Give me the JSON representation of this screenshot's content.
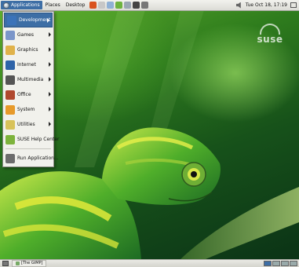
{
  "top_panel": {
    "applications_label": "Applications",
    "places_label": "Places",
    "desktop_label": "Desktop",
    "launchers": [
      {
        "icon": "firefox-icon",
        "color": "#d9531e"
      },
      {
        "icon": "mail-icon",
        "color": "#c7c7c7"
      },
      {
        "icon": "office-icon",
        "color": "#8fb0d6"
      },
      {
        "icon": "help-icon",
        "color": "#6db33f"
      },
      {
        "icon": "search-icon",
        "color": "#9aa6b3"
      },
      {
        "icon": "terminal-icon",
        "color": "#444444"
      },
      {
        "icon": "screenshot-icon",
        "color": "#777777"
      }
    ],
    "clock": "Tue Oct 18, 17:19"
  },
  "applications_menu": {
    "items": [
      {
        "label": "Development",
        "icon": "development-icon",
        "color": "#3b73b9",
        "submenu": true,
        "selected": true
      },
      {
        "label": "Games",
        "icon": "games-icon",
        "color": "#7b96c9",
        "submenu": true
      },
      {
        "label": "Graphics",
        "icon": "graphics-icon",
        "color": "#e0b24a",
        "submenu": true
      },
      {
        "label": "Internet",
        "icon": "internet-icon",
        "color": "#2f64a8",
        "submenu": true
      },
      {
        "label": "Multimedia",
        "icon": "multimedia-icon",
        "color": "#555555",
        "submenu": true
      },
      {
        "label": "Office",
        "icon": "office-icon",
        "color": "#b0482f",
        "submenu": true
      },
      {
        "label": "System",
        "icon": "system-icon",
        "color": "#e79a2a",
        "submenu": true
      },
      {
        "label": "Utilities",
        "icon": "utilities-icon",
        "color": "#d8c25a",
        "submenu": true
      },
      {
        "label": "SUSE Help Center",
        "icon": "help-center-icon",
        "color": "#7db33c",
        "submenu": false
      }
    ],
    "run_application": {
      "label": "Run Application...",
      "icon": "run-application-icon",
      "color": "#6c6c6c"
    }
  },
  "desktop": {
    "brand": "suse"
  },
  "bottom_panel": {
    "task_label": "[The GIMP]",
    "workspaces": 4,
    "active_workspace": 1
  }
}
